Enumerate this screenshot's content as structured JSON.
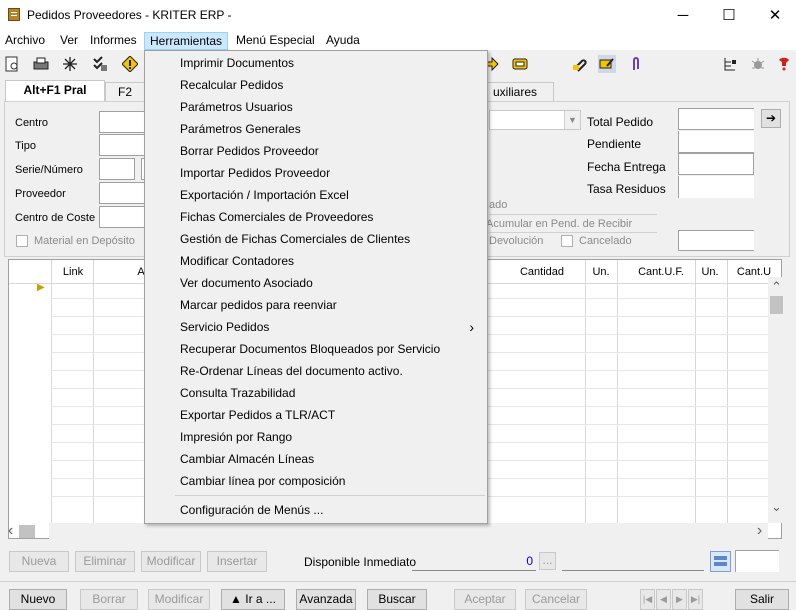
{
  "window": {
    "title": "Pedidos Proveedores - KRITER ERP -",
    "minimize": "─",
    "maximize": "☐",
    "close": "✕"
  },
  "menubar": [
    "Archivo",
    "Ver",
    "Informes",
    "Herramientas",
    "Menú Especial",
    "Ayuda"
  ],
  "tabs": [
    "Alt+F1 Pral",
    "F2",
    "uxiliares"
  ],
  "form": {
    "centro": "Centro",
    "tipo": "Tipo",
    "serie": "Serie/Número",
    "proveedor": "Proveedor",
    "centro_coste": "Centro de Coste",
    "material_deposito": "Material en Depósito",
    "total_pedido": "Total Pedido",
    "pendiente": "Pendiente",
    "fecha_entrega": "Fecha Entrega",
    "tasa_residuos": "Tasa Residuos",
    "ado": "ado",
    "acumular": "Acumular en Pend. de Recibir",
    "devolucion": "Devolución",
    "cancelado": "Cancelado",
    "arrow": "➔"
  },
  "grid": {
    "headers": [
      "Link",
      "A",
      "Cantidad",
      "Un.",
      "Cant.U.F.",
      "Un.",
      "Cant.U"
    ]
  },
  "dropdown": {
    "items": [
      "Imprimir Documentos",
      "Recalcular Pedidos",
      "Parámetros Usuarios",
      "Parámetros Generales",
      "Borrar Pedidos Proveedor",
      "Importar Pedidos Proveedor",
      "Exportación / Importación Excel",
      "Fichas Comerciales de Proveedores",
      "Gestión de Fichas Comerciales de Clientes",
      "Modificar Contadores",
      "Ver documento Asociado",
      "Marcar pedidos para reenviar",
      "Servicio Pedidos",
      "Recuperar Documentos Bloqueados por Servicio",
      "Re-Ordenar Líneas del documento activo.",
      "Consulta Trazabilidad",
      "Exportar Pedidos a TLR/ACT",
      "Impresión por Rango",
      "Cambiar Almacén Líneas",
      "Cambiar línea por composición"
    ],
    "submenu_arrow": "›",
    "last": "Configuración de Menús ..."
  },
  "lines_bar": {
    "nueva": "Nueva",
    "eliminar": "Eliminar",
    "modificar": "Modificar",
    "insertar": "Insertar",
    "disponible": "Disponible Inmediato",
    "disponible_value": "0",
    "ellipsis": "..."
  },
  "bottom": {
    "nuevo": "Nuevo",
    "borrar": "Borrar",
    "modificar": "Modificar",
    "ira": "▲ Ir a ...",
    "avanzada": "Avanzada",
    "buscar": "Buscar",
    "aceptar": "Aceptar",
    "cancelar": "Cancelar",
    "salir": "Salir"
  },
  "nav": [
    "|◀",
    "◀",
    "▶",
    "▶|"
  ],
  "scroll": {
    "up": "⌃",
    "down": "⌄",
    "left": "‹",
    "right": "›"
  },
  "colors": {
    "menu_highlight": "#cce8ff",
    "accent": "#0078d7"
  }
}
